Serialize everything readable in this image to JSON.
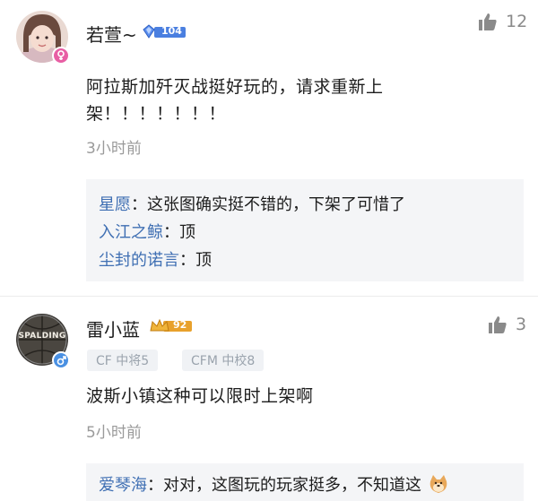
{
  "comments": [
    {
      "username": "若萱~",
      "level_badge": "104",
      "likes": "12",
      "content_line1": "阿拉斯加歼灭战挺好玩的，请求重新上",
      "content_line2": "架！！！！！！！",
      "time": "3小时前",
      "replies": [
        {
          "name": "星愿",
          "sep": "：",
          "text": "这张图确实挺不错的，下架了可惜了"
        },
        {
          "name": "入江之鲸",
          "sep": "：",
          "text": "顶"
        },
        {
          "name": "尘封的诺言",
          "sep": "：",
          "text": "顶"
        }
      ],
      "gender": "female"
    },
    {
      "username": "雷小蓝",
      "level_badge": "92",
      "likes": "3",
      "tags": [
        "CF 中将5",
        "CFM 中校8"
      ],
      "content": "波斯小镇这种可以限时上架啊",
      "time": "5小时前",
      "replies": [
        {
          "name": "爱琴海",
          "sep": "：",
          "text": "对对，这图玩的玩家挺多，不知道这"
        }
      ],
      "gender": "male",
      "avatar_text": "SPALDING"
    }
  ],
  "colors": {
    "reply_name": "#3f6fb3",
    "female_badge": "#e85ea4",
    "male_badge": "#4a90e2",
    "badge_blue": "#4a7fe0",
    "badge_gold": "#e8a12c"
  }
}
